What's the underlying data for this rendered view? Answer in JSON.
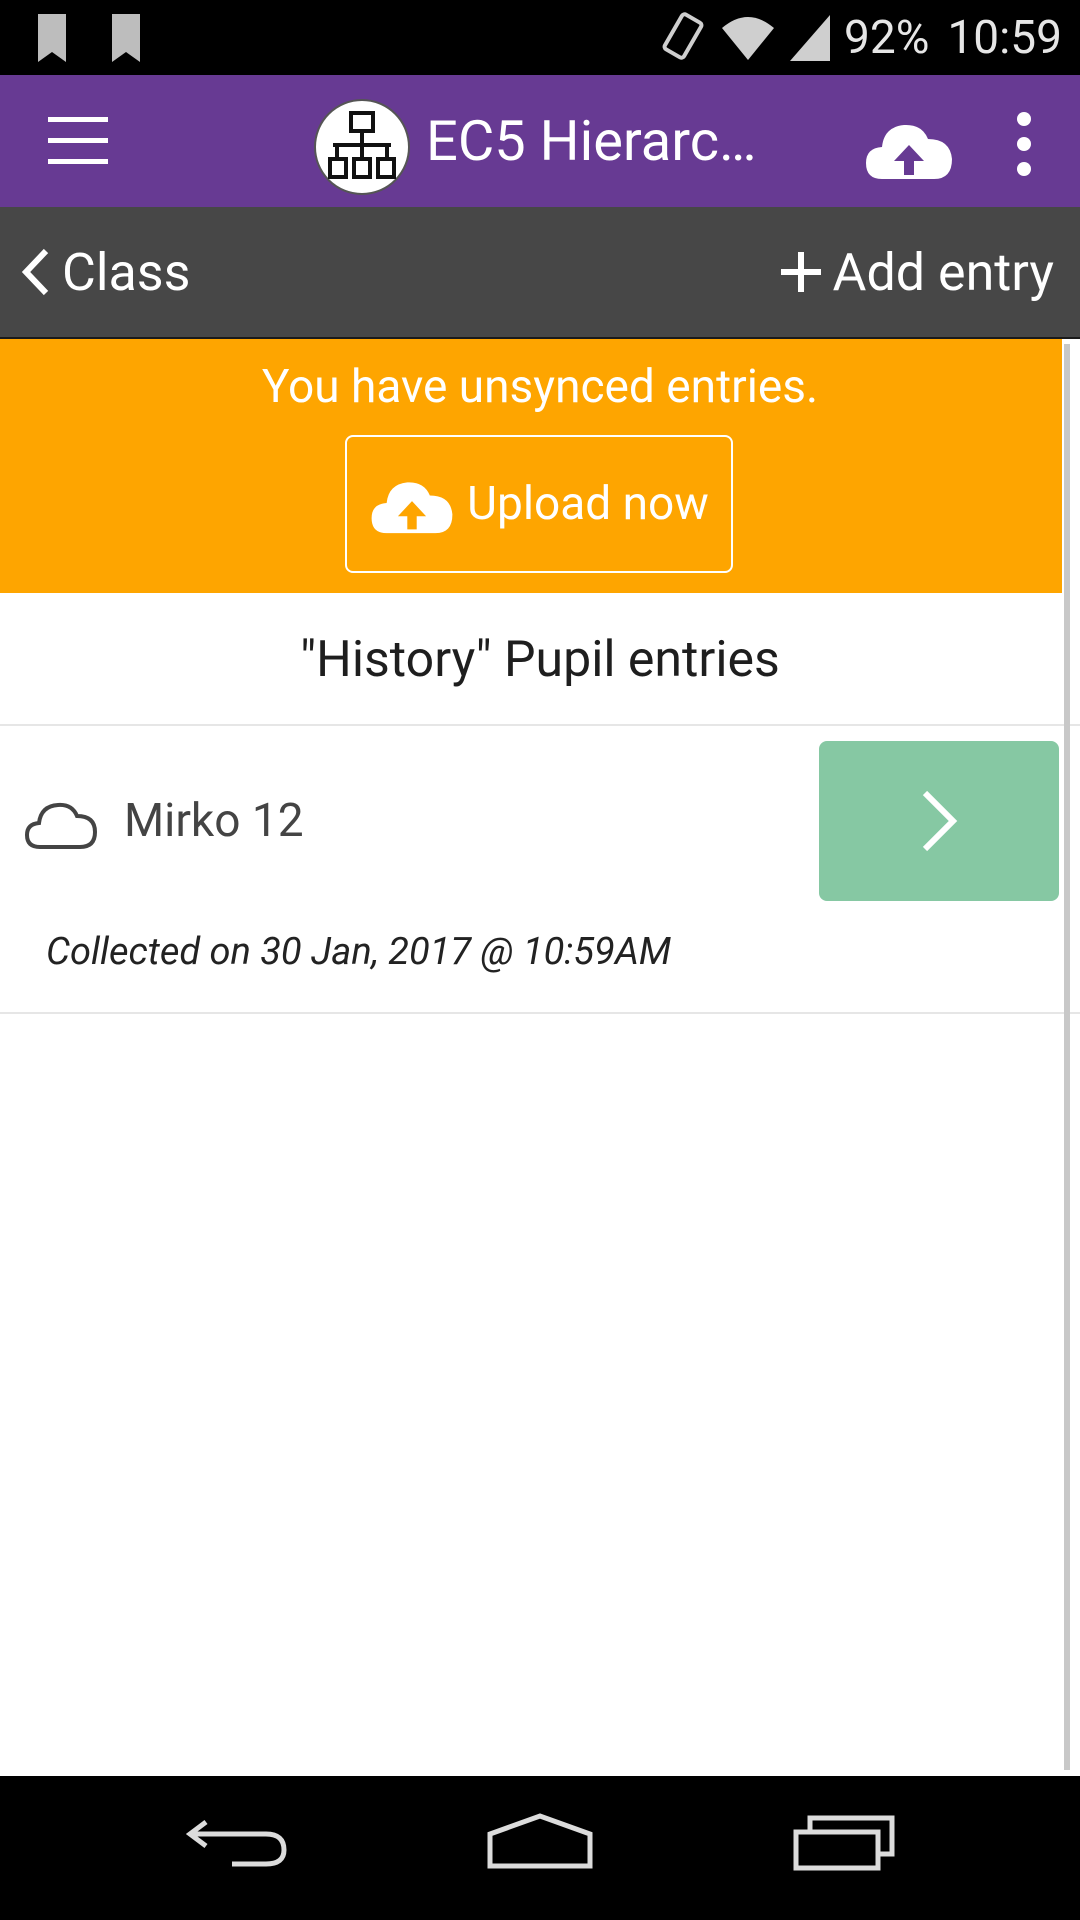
{
  "status_bar": {
    "battery": "92%",
    "time": "10:59",
    "icons": [
      "bookmark-icon",
      "bookmark-icon",
      "vibrate-icon",
      "wifi-icon",
      "signal-icon"
    ]
  },
  "app_bar": {
    "title": "EC5 Hierarc…",
    "icons": [
      "menu-icon",
      "hierarchy-logo-icon",
      "cloud-upload-icon",
      "more-vert-icon"
    ]
  },
  "nav_bar": {
    "back_label": "Class",
    "add_label": "Add entry"
  },
  "banner": {
    "message": "You have unsynced entries.",
    "button_label": "Upload now",
    "color": "#fea500"
  },
  "list": {
    "header": "\"History\" Pupil entries",
    "entries": [
      {
        "title": "Mirko 12",
        "collected": "Collected on 30 Jan, 2017 @ 10:59AM",
        "status_icon": "cloud-outline-icon"
      }
    ]
  },
  "colors": {
    "app_bar": "#673a93",
    "nav_bar": "#474747",
    "open_button": "#86c8a3"
  }
}
